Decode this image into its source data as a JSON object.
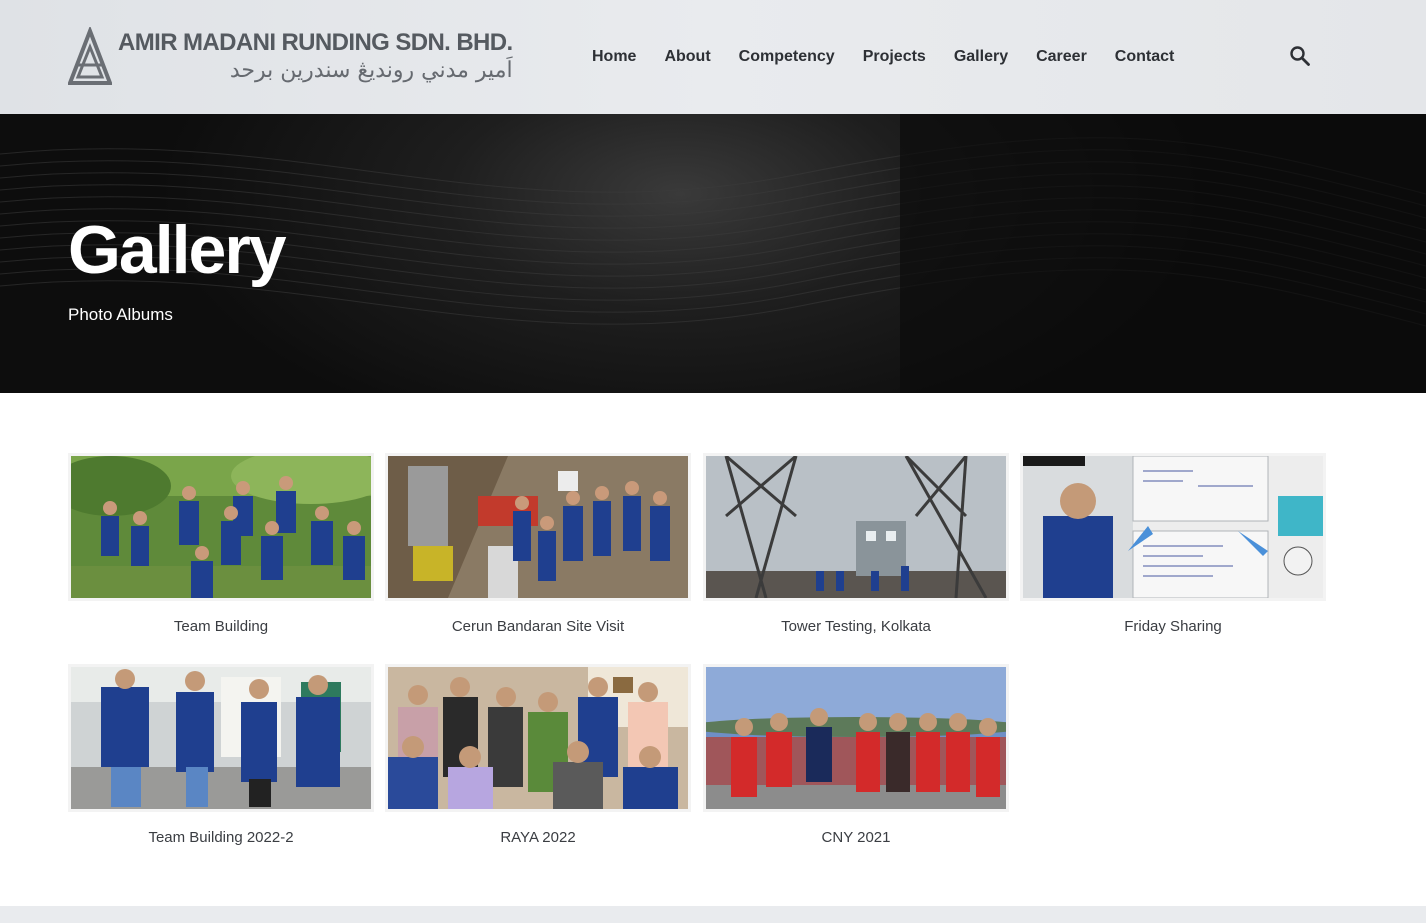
{
  "site": {
    "company_name": "AMIR MADANI RUNDING SDN. BHD.",
    "company_name_arabic": "اَمير مدني رونديڠ سندرين برحد"
  },
  "nav": {
    "items": [
      {
        "label": "Home"
      },
      {
        "label": "About"
      },
      {
        "label": "Competency"
      },
      {
        "label": "Projects"
      },
      {
        "label": "Gallery"
      },
      {
        "label": "Career"
      },
      {
        "label": "Contact"
      }
    ],
    "search_icon": "search-icon"
  },
  "hero": {
    "title": "Gallery",
    "subtitle": "Photo Albums"
  },
  "albums": [
    {
      "title": "Team Building",
      "scene": "outdoor-team-green"
    },
    {
      "title": "Cerun Bandaran Site Visit",
      "scene": "construction-site"
    },
    {
      "title": "Tower Testing, Kolkata",
      "scene": "transmission-tower"
    },
    {
      "title": "Friday Sharing",
      "scene": "whiteboard-presentation"
    },
    {
      "title": "Team Building 2022-2",
      "scene": "group-porch"
    },
    {
      "title": "RAYA 2022",
      "scene": "festive-group-indoor"
    },
    {
      "title": "CNY 2021",
      "scene": "red-shirts-rooftop"
    }
  ],
  "colors": {
    "header_bg": "#e4e6e9",
    "hero_bg": "#111111",
    "nav_text": "#2d3035",
    "uniform_blue": "#1f3f8f"
  }
}
